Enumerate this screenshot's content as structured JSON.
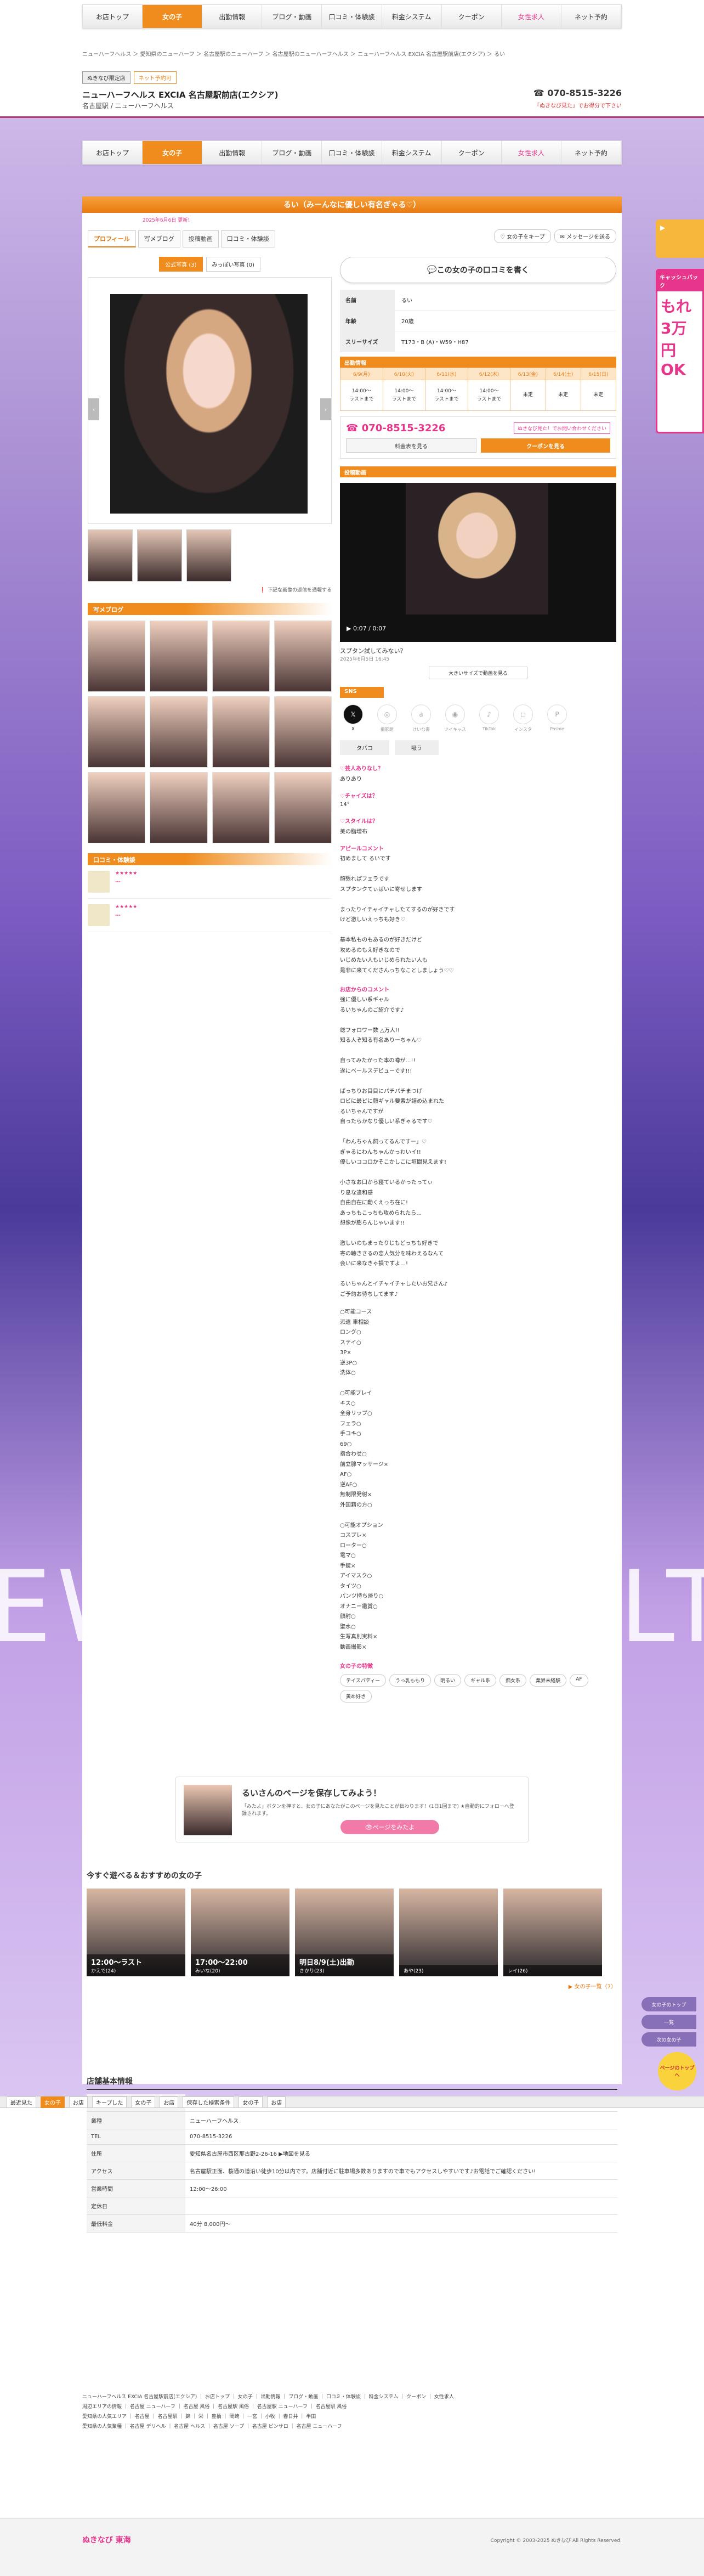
{
  "nav": [
    "お店トップ",
    "女の子",
    "出勤情報",
    "ブログ・動画",
    "口コミ・体験談",
    "料金システム",
    "クーポン",
    "女性求人",
    "ネット予約"
  ],
  "breadcrumb": "ニューハーフヘルス ＞ 愛知県のニューハーフ ＞ 名古屋駅のニューハーフ ＞ 名古屋駅のニューハーフヘルス ＞ ニューハーフヘルス EXCIA 名古屋駅前店(エクシア) ＞ るい",
  "shop": {
    "tags": [
      "ぬきなび限定店",
      "ネット予約可"
    ],
    "name": "ニューハーフヘルス EXCIA 名古屋駅前店(エクシア)",
    "area": "名古屋駅 / ニューハーフヘルス",
    "tel": "070-8515-3226",
    "tel_note": "「ぬきなび見た」でお得分で下さい"
  },
  "girl": {
    "title": "るい（みーんなに優しい有名ぎゃる♡）",
    "updated": "2025年6月6日 更新！",
    "tabs": [
      "プロフィール",
      "写メブログ",
      "投稿動画",
      "口コミ・体験談"
    ],
    "actions": [
      "女の子をキープ",
      "メッセージを送る"
    ],
    "photo_tabs": [
      "公式写真 (3)",
      "みっぽい写真 (0)"
    ],
    "photo_note": "下記な画像の返信を通報する",
    "name_label": "名前",
    "name": "るい",
    "age_label": "年齢",
    "age": "20歳",
    "three_label": "スリーサイズ",
    "three": "T173・B (A)・W59・H87",
    "write_review": "この女の子の口コミを書く"
  },
  "schedule": {
    "header": "出勤情報",
    "days": [
      "6/9(月)",
      "6/10(火)",
      "6/11(水)",
      "6/12(木)",
      "6/13(金)",
      "6/14(土)",
      "6/15(日)"
    ],
    "times": [
      "14:00～\nラストまで",
      "14:00～\nラストまで",
      "14:00～\nラストまで",
      "14:00～\nラストまで",
      "未定",
      "未定",
      "未定"
    ],
    "tel": "070-8515-3226",
    "tel_badge": "ぬきなび見た！でお問い合わせください",
    "price_btn": "料金表を見る",
    "coupon_btn": "クーポンを見る"
  },
  "video": {
    "header": "投稿動画",
    "time": "0:07 / 0:07",
    "caption": "スプタン試してみない？",
    "date": "2025年6月5日 16:45",
    "big_btn": "大きいサイズで動画を見る"
  },
  "sns": {
    "header": "SNS",
    "items": [
      "X",
      "撮影館",
      "けいな書",
      "ツイキャス",
      "TikTok",
      "インスタ",
      "Pashie"
    ]
  },
  "profile_tabs": [
    "タバコ",
    "吸う"
  ],
  "qa": [
    {
      "q": "♡芸人ありなし？",
      "a": "ありあり"
    },
    {
      "q": "♡チャイズは？",
      "a": "14°"
    },
    {
      "q": "♡スタイルは？",
      "a": "美の脂増布"
    }
  ],
  "appeal": {
    "h": "アピールコメント",
    "text": "初めまして るいです\n\n頑張ればフェラです\nスプタンクてぃばいに寄せします\n\nまったりイチャイチャしたてするのが好きです\nけど激しいえっちも好き♡\n\n基本私ものもあるのが好きだけど\n攻めるのもえ好きなので\nいじめたい人もいじめられたい人も\n是非に来てくださんっちなことしましょう♡♡"
  },
  "shop_comment": {
    "h": "お店からのコメント",
    "text": "強に優しい系ギャル\nるいちゃんのご紹介です♪\n\n総フォロワー数 △万人!!\n知る人ぞ知る有名ありーちゃん♡\n\n自ってみたかった本の噂が…!!\n遂にベールスデビューです!!!\n\nぱっちりお目目にパチパチまつげ\nロビに最ピに顔ギャル要素が詰め込まれた\nるいちゃんですが\n自ったらかなり優しい系ぎゃるです♡\n\n「わんちゃん飼ってるんですー」♡\nぎゃるにわんちゃんかっわいイ!!\n優しいココロかそこかしこに垣間見えます!\n\n小さなお口から寝ているかったってぃ\nり息な違和感\n自由自在に動くえっち在に!\nあっちもこっちも攻められたら…\n想像が膨らんじゃいます!!\n\n激しいのもまったりじもどっちも好きで\n寄の聴きさるの恋人気分を味わえるなんて\n会いに来なきゃ損ですよ…!\n\nるいちゃんとイチャイチャしたいお兄さん♪\nご予約お待ちしてます♪"
  },
  "options": {
    "text": "○可能コース\n派遣 車相談\nロング○\nステイ○\n3P×\n逆3P○\n洗体○\n\n○可能プレイ\nキス○\n全身リップ○\nフェラ○\n手コキ○\n69○\n指合わせ○\n前立腺マッサージ×\nAF○\n逆AF○\n無制限発射×\n外国籍の方○\n\n○可能オプション\nコスプレ×\nローター○\n電マ○\n手錠×\nアイマスク○\nタイツ○\nパンツ持ち帰り○\nオナニー鑑賞○\n顔射○\n聖水○\n生写真別実料×\n動画撮影×"
  },
  "traits": {
    "h": "女の子の特徴",
    "tags": [
      "テイスパディー",
      "うっ乳ももり",
      "明るい",
      "ギャル系",
      "痴女系",
      "業界未経験",
      "AF",
      "黄め好き"
    ]
  },
  "save": {
    "title": "るいさんのページを保存してみよう！",
    "desc": "「みたよ」ボタンを押すと、女の子にあなたがこのページを見たことが伝わります！(1日1回まで) ★自動的にフォローへ登録されます。",
    "btn": "ページをみたよ"
  },
  "recommend": {
    "h": "今すぐ遊べる＆おすすめの女の子",
    "cards": [
      {
        "time": "12:00～ラスト",
        "name": "かえで(24)"
      },
      {
        "time": "17:00～22:00",
        "name": "みいな(20)"
      },
      {
        "time": "明日8/9(土)出勤",
        "name": "きかり(23)"
      },
      {
        "time": "",
        "name": "あや(23)"
      },
      {
        "time": "",
        "name": "レイ(26)"
      }
    ],
    "more": "女の子一覧（7）"
  },
  "shopinfo": {
    "h": "店舗基本情報",
    "rows": [
      {
        "k": "店名",
        "v": "ニューハーフヘルス EXCIA 名古屋駅前店"
      },
      {
        "k": "業種",
        "v": "ニューハーフヘルス"
      },
      {
        "k": "TEL",
        "v": "070-8515-3226"
      },
      {
        "k": "住所",
        "v": "愛知県名古屋市西区那古野2-26-16 ▶地図を見る"
      },
      {
        "k": "アクセス",
        "v": "名古屋駅正面、桜通の道沿い徒歩10分以内です。店舗付近に駐車場多数ありますので車でもアクセスしやすいです♪お電話でご確認ください!"
      },
      {
        "k": "営業時間",
        "v": "12:00～26:00"
      },
      {
        "k": "定休日",
        "v": ""
      },
      {
        "k": "最低料金",
        "v": "40分 8,000円～"
      }
    ]
  },
  "footer": {
    "line1": "ニューハーフヘルス EXCIA 名古屋駅前店(エクシア) ｜ お店トップ ｜ 女の子 ｜ 出勤情報 ｜ ブログ・動画 ｜ 口コミ・体験談 ｜ 料金システム ｜ クーポン ｜ 女性求人",
    "line2": "周辺エリアの情報 ｜ 名古屋 ニューハーフ ｜ 名古屋 風俗 ｜ 名古屋駅 風俗 ｜ 名古屋駅 ニューハーフ ｜ 名古屋駅 風俗",
    "line3": "愛知県の人気エリア ｜ 名古屋 ｜ 名古屋駅 ｜ 錦 ｜ 栄 ｜ 豊橋 ｜ 岡崎 ｜ 一宮 ｜ 小牧 ｜ 春日井 ｜ 半田",
    "line4": "愛知県の人気業種 ｜ 名古屋 デリヘル ｜ 名古屋 ヘルス ｜ 名古屋 ソープ ｜ 名古屋 ピンサロ ｜ 名古屋 ニューハーフ",
    "logo": "ぬきなび 東海",
    "copyright": "Copyright © 2003-2025 ぬきなび All Rights Reserved."
  },
  "sticky": [
    "最近見た",
    "女の子",
    "お店",
    "キープした",
    "女の子",
    "お店",
    "保存した検索条件",
    "女の子",
    "お店"
  ],
  "side": {
    "ticket": "キャッシュバック",
    "big": "もれ 3万円 OK",
    "nav_top": "女の子のトップ",
    "nav_list": "一覧",
    "nav_other": "次の女の子",
    "cta": "ページのトップへ"
  },
  "bigtext": [
    "EW",
    "LT"
  ]
}
